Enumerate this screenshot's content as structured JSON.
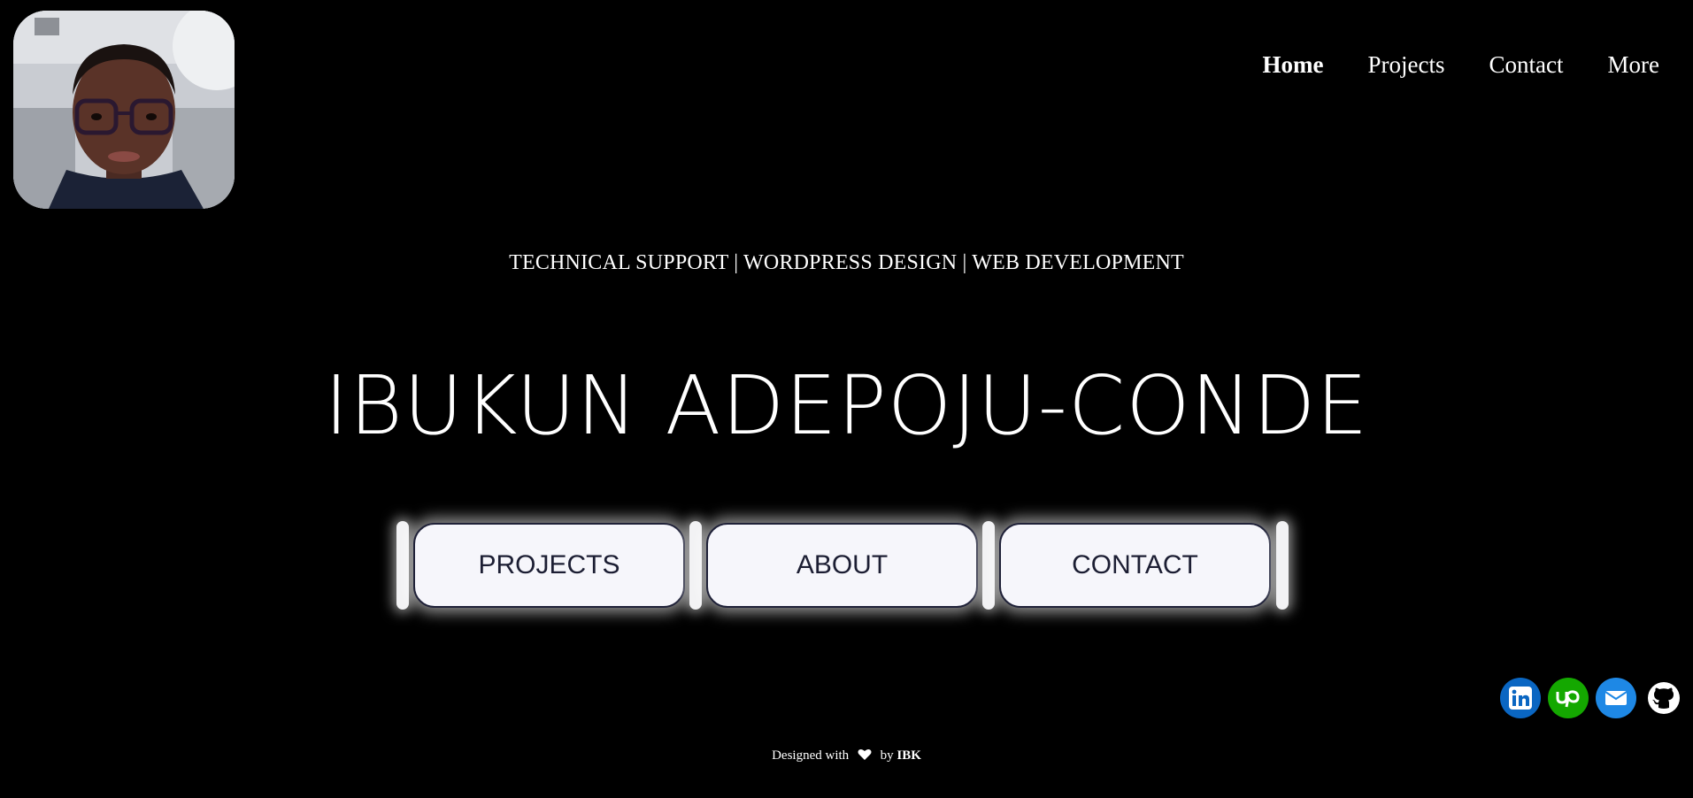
{
  "nav": {
    "items": [
      {
        "label": "Home",
        "active": true
      },
      {
        "label": "Projects",
        "active": false
      },
      {
        "label": "Contact",
        "active": false
      },
      {
        "label": "More",
        "active": false
      }
    ]
  },
  "hero": {
    "tagline": "TECHNICAL SUPPORT | WORDPRESS DESIGN | WEB DEVELOPMENT",
    "name": "IBUKUN ADEPOJU-CONDE"
  },
  "buttons": {
    "projects": "PROJECTS",
    "about": "ABOUT",
    "contact": "CONTACT"
  },
  "social": {
    "icons": [
      "linkedin-icon",
      "upwork-icon",
      "email-icon",
      "github-icon"
    ],
    "colors": {
      "linkedin": "#0a66c2",
      "upwork": "#14a800",
      "email": "#1e88e5",
      "github": "#ffffff"
    }
  },
  "footer": {
    "designed_with": "Designed with",
    "by": "by",
    "author": "IBK"
  }
}
